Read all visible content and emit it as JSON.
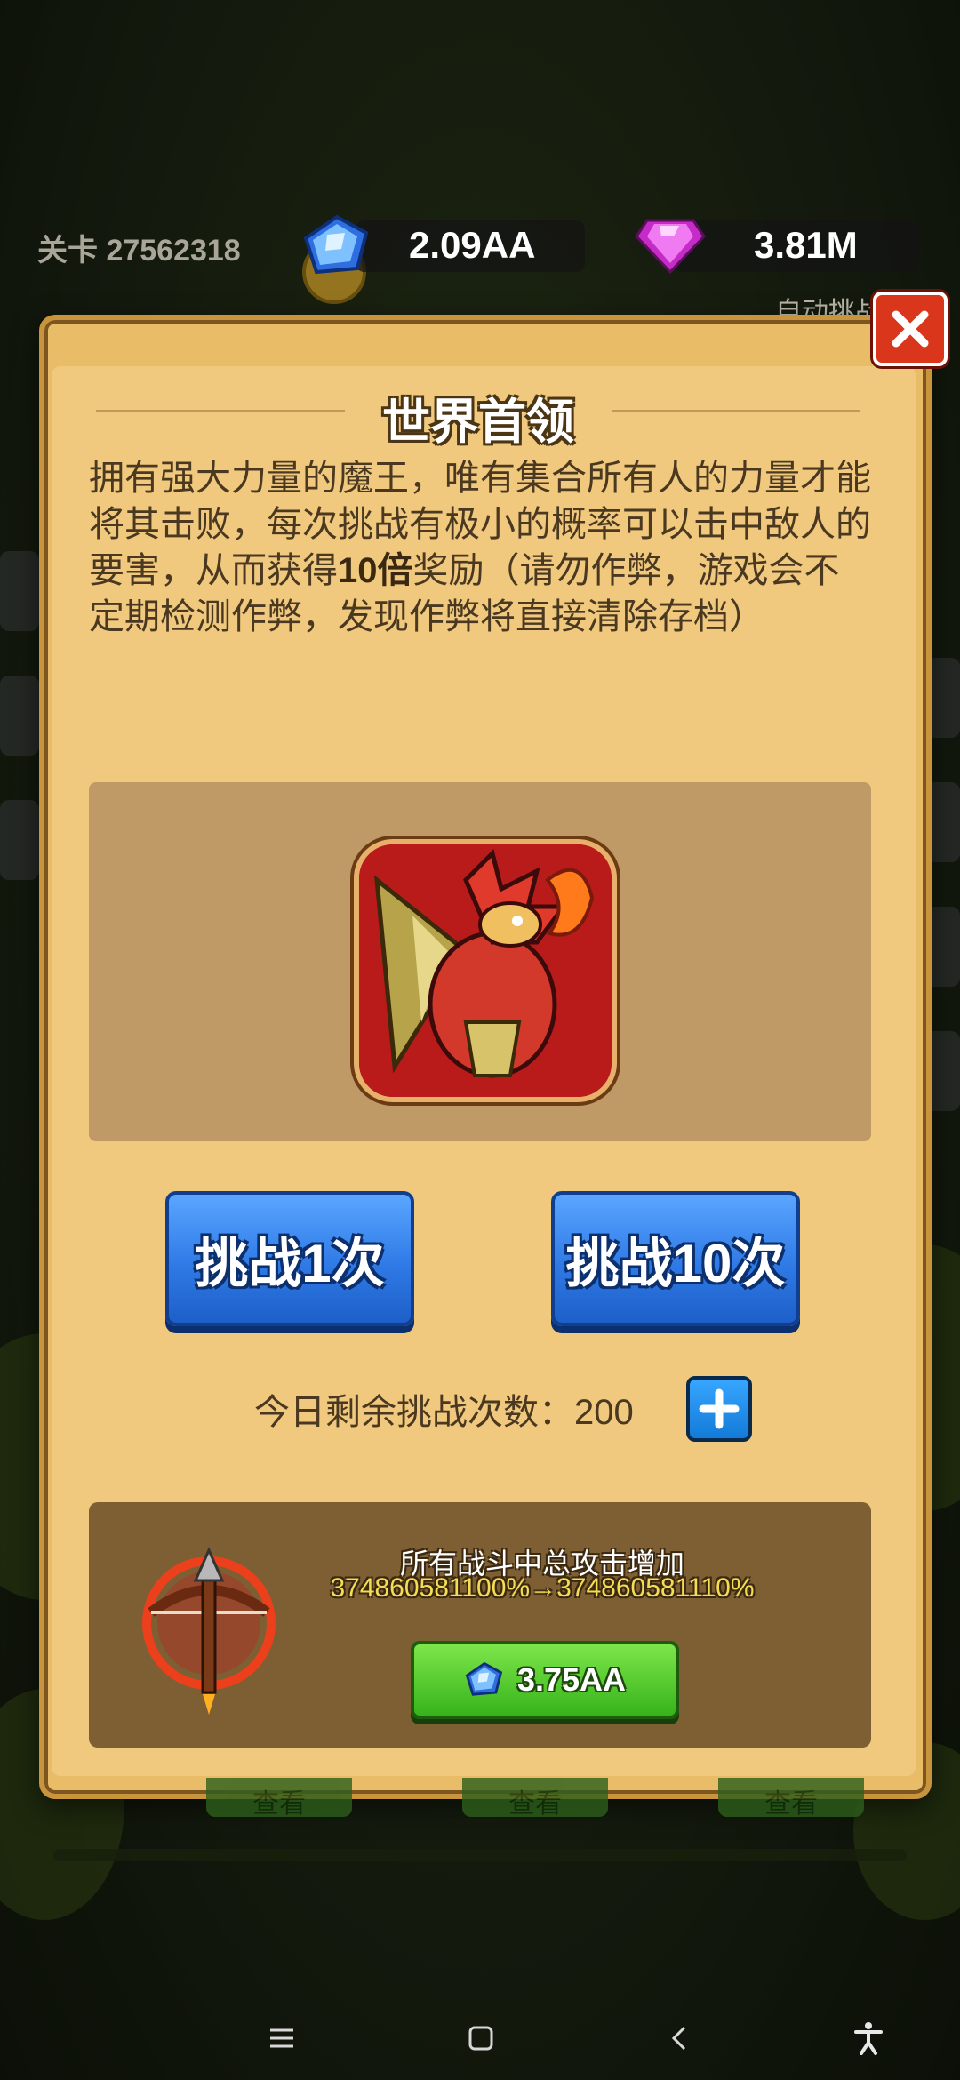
{
  "topbar": {
    "level_label": "关卡 27562318",
    "blue_gem_value": "2.09AA",
    "pink_gem_value": "3.81M",
    "auto_challenge_label": "自动挑战"
  },
  "dialog": {
    "title": "世界首领",
    "description_before": "拥有强大力量的魔王，唯有集合所有人的力量才能将其击败，每次挑战有极小的概率可以击中敌人的要害，从而获得",
    "description_bold": "10倍",
    "description_after": "奖励（请勿作弊，游戏会不定期检测作弊，发现作弊将直接清除存档）",
    "challenge_once_label": "挑战1次",
    "challenge_ten_label": "挑战10次",
    "remaining_label": "今日剩余挑战次数：",
    "remaining_count": "200",
    "upgrade": {
      "title": "所有战斗中总攻击增加",
      "value": "374860581100%→374860581110%",
      "cost": "3.75AA"
    }
  },
  "background_tabs": [
    "查看",
    "查看",
    "查看"
  ],
  "icons": {
    "blue_gem": "blue-gem-icon",
    "pink_gem": "pink-gem-icon",
    "close": "close-icon",
    "plus": "plus-icon",
    "crossbow": "crossbow-icon",
    "boss": "dragon-boss-portrait"
  },
  "colors": {
    "panel": "#e9bd68",
    "blue_button": "#2f7ae6",
    "green_button": "#37b31b",
    "close_button": "#d9361c",
    "highlight_text": "#f4dd55"
  }
}
